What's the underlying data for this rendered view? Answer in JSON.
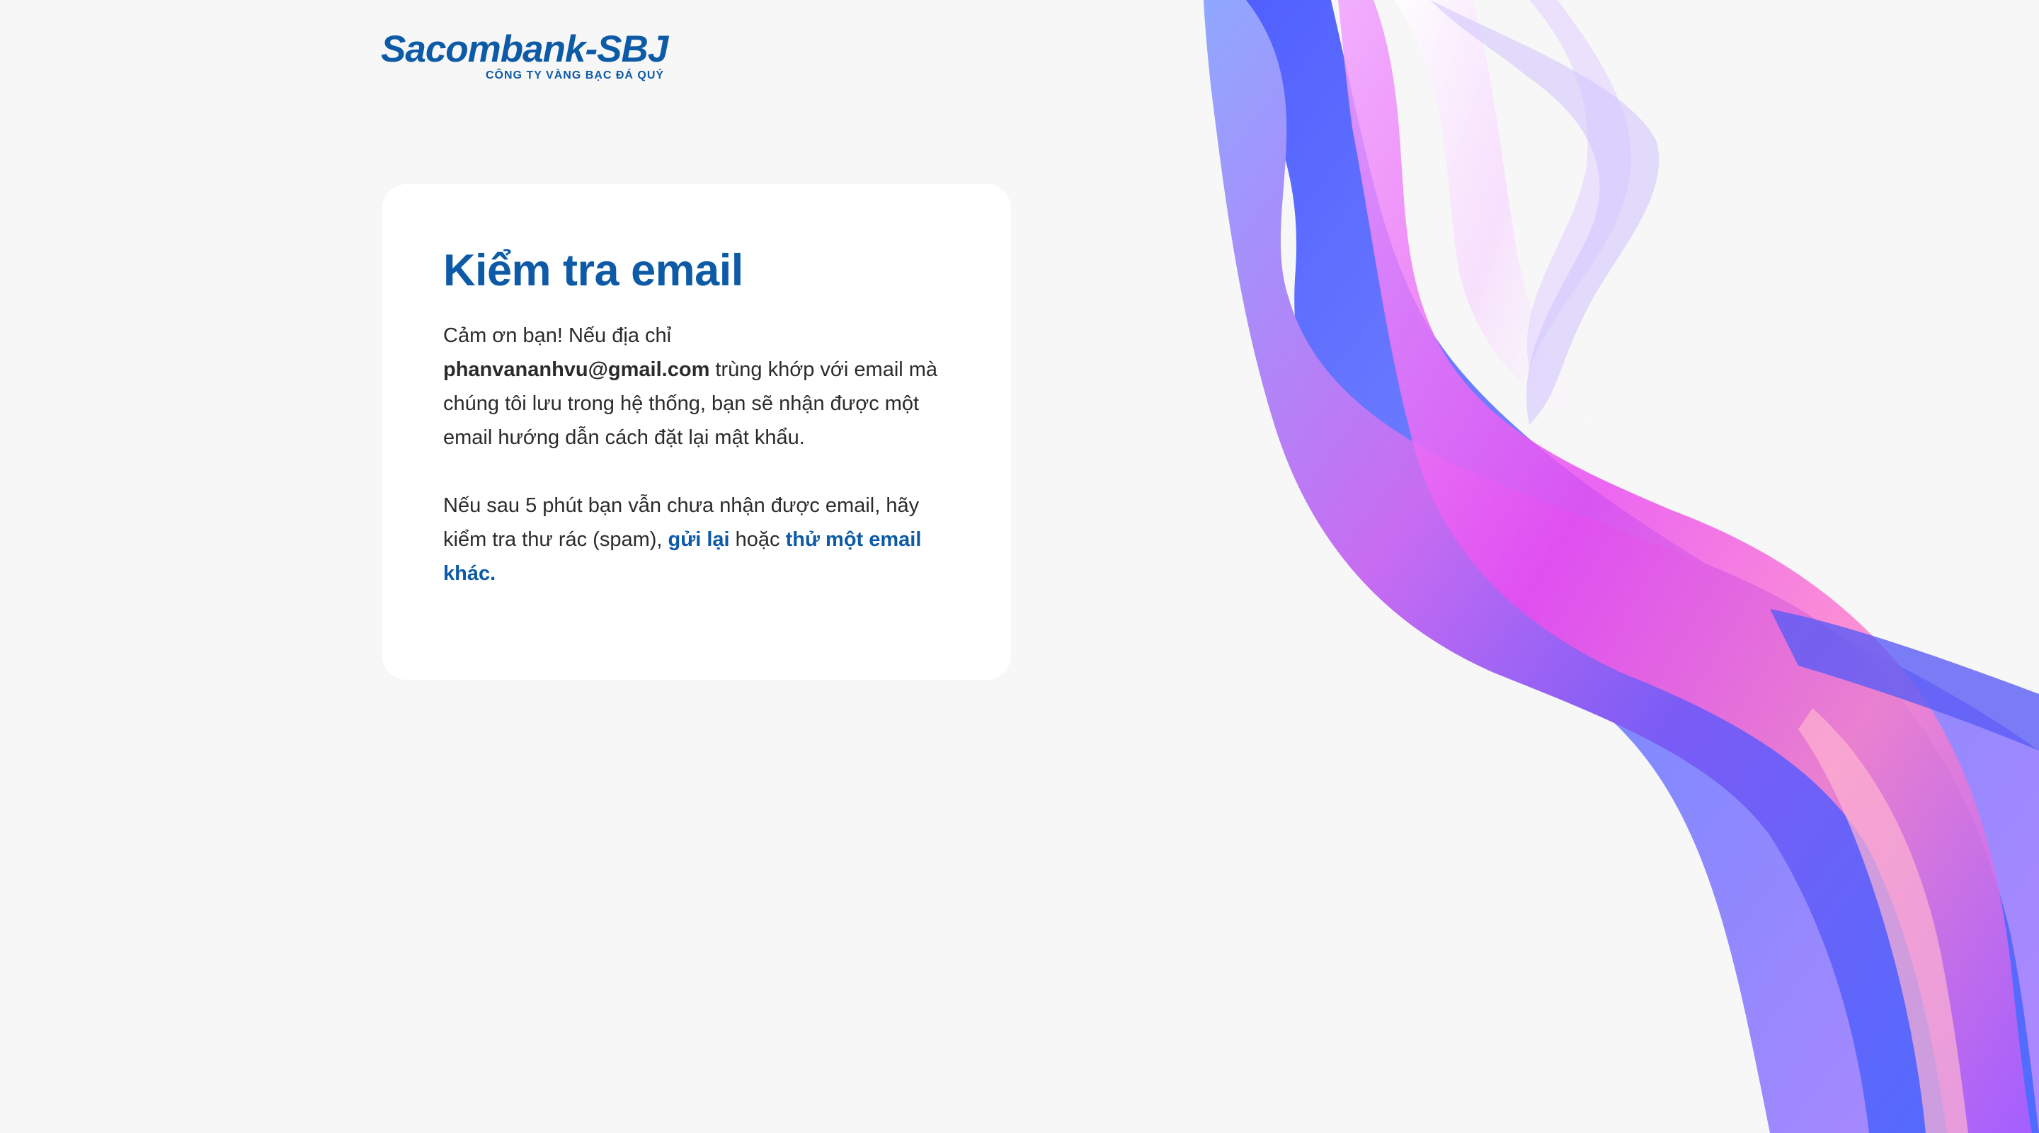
{
  "logo": {
    "wordmark": "Sacombank-SBJ",
    "subtitle": "CÔNG TY VÀNG BẠC ĐÁ QUÝ"
  },
  "card": {
    "title": "Kiểm tra email",
    "paragraph1_prefix": "Cảm ơn bạn! Nếu địa chỉ ",
    "email": "phanvananhvu@gmail.com",
    "paragraph1_suffix": " trùng khớp với email mà chúng tôi lưu trong hệ thống, bạn sẽ nhận được một email hướng dẫn cách đặt lại mật khẩu.",
    "paragraph2_prefix": "Nếu sau 5 phút bạn vẫn chưa nhận được email, hãy kiểm tra thư rác (spam), ",
    "resend_link": "gửi lại",
    "paragraph2_middle": " hoặc ",
    "try_other_link": "thử một email khác."
  },
  "colors": {
    "brand": "#0d5aa7",
    "background": "#f7f7f7",
    "card": "#ffffff",
    "text": "#2b2b2b"
  }
}
